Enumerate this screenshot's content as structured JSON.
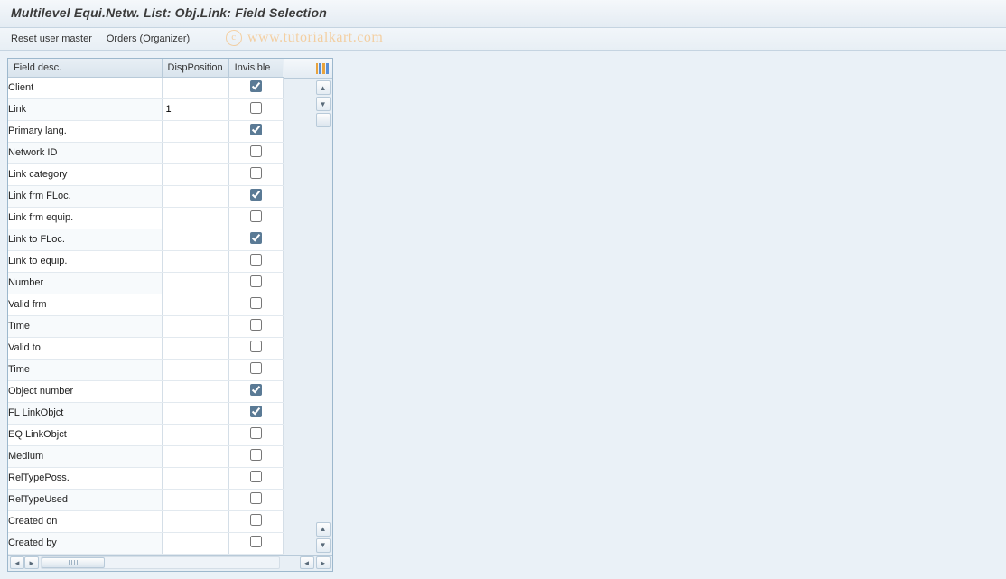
{
  "header": {
    "title": "Multilevel Equi.Netw. List: Obj.Link: Field Selection"
  },
  "toolbar": {
    "reset_label": "Reset user master",
    "orders_label": "Orders (Organizer)"
  },
  "watermark": "www.tutorialkart.com",
  "columns": {
    "field": "Field desc.",
    "disp": "DispPosition",
    "inv": "Invisible"
  },
  "rows": [
    {
      "field": "Client",
      "disp": "",
      "inv": true
    },
    {
      "field": "Link",
      "disp": "1",
      "inv": false
    },
    {
      "field": "Primary lang.",
      "disp": "",
      "inv": true
    },
    {
      "field": "Network ID",
      "disp": "",
      "inv": false
    },
    {
      "field": "Link category",
      "disp": "",
      "inv": false
    },
    {
      "field": "Link frm FLoc.",
      "disp": "",
      "inv": true
    },
    {
      "field": "Link frm equip.",
      "disp": "",
      "inv": false
    },
    {
      "field": "Link to FLoc.",
      "disp": "",
      "inv": true
    },
    {
      "field": "Link to equip.",
      "disp": "",
      "inv": false
    },
    {
      "field": "Number",
      "disp": "",
      "inv": false
    },
    {
      "field": "Valid frm",
      "disp": "",
      "inv": false
    },
    {
      "field": "Time",
      "disp": "",
      "inv": false
    },
    {
      "field": "Valid to",
      "disp": "",
      "inv": false
    },
    {
      "field": "Time",
      "disp": "",
      "inv": false
    },
    {
      "field": "Object number",
      "disp": "",
      "inv": true
    },
    {
      "field": "FL LinkObjct",
      "disp": "",
      "inv": true
    },
    {
      "field": "EQ LinkObjct",
      "disp": "",
      "inv": false
    },
    {
      "field": "Medium",
      "disp": "",
      "inv": false
    },
    {
      "field": "RelTypePoss.",
      "disp": "",
      "inv": false
    },
    {
      "field": "RelTypeUsed",
      "disp": "",
      "inv": false
    },
    {
      "field": "Created on",
      "disp": "",
      "inv": false
    },
    {
      "field": "Created by",
      "disp": "",
      "inv": false
    }
  ]
}
